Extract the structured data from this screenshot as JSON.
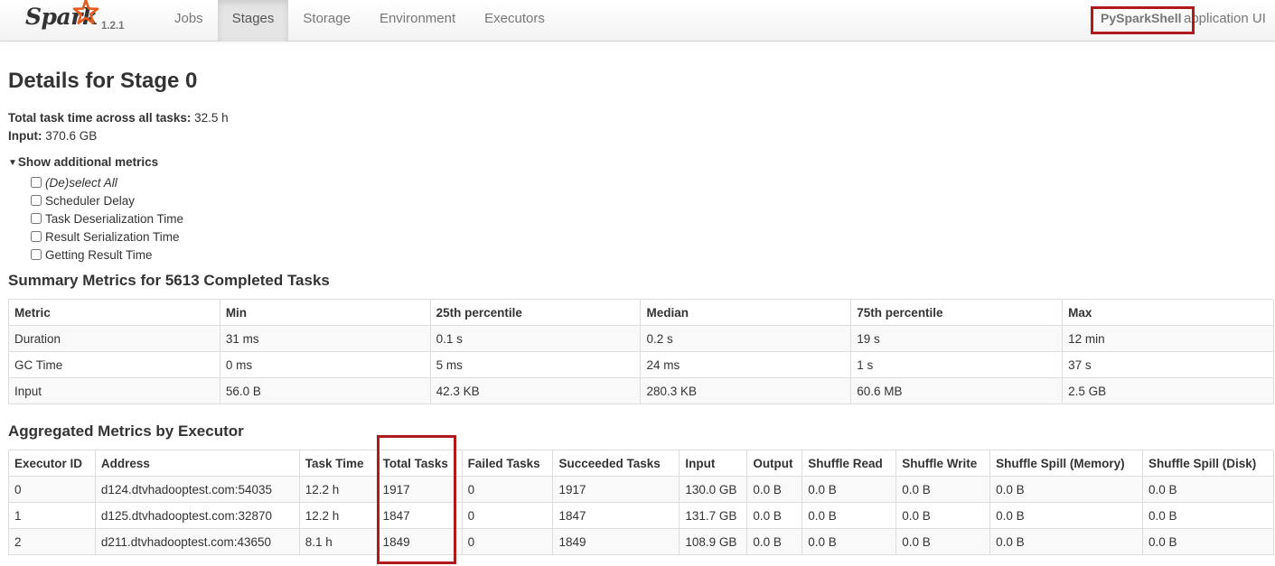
{
  "brand": {
    "name": "Spark",
    "version": "1.2.1",
    "star_color": "#e25a1c"
  },
  "nav": {
    "tabs": [
      {
        "label": "Jobs"
      },
      {
        "label": "Stages",
        "active": true
      },
      {
        "label": "Storage"
      },
      {
        "label": "Environment"
      },
      {
        "label": "Executors"
      }
    ],
    "app_name": "PySparkShell",
    "app_suffix": "application UI"
  },
  "page": {
    "title": "Details for Stage 0",
    "total_task_time_label": "Total task time across all tasks:",
    "total_task_time_value": "32.5 h",
    "input_label": "Input:",
    "input_value": "370.6 GB"
  },
  "additional_metrics": {
    "toggle_label": "Show additional metrics",
    "options": [
      {
        "label": "(De)select All",
        "italic": true
      },
      {
        "label": "Scheduler Delay"
      },
      {
        "label": "Task Deserialization Time"
      },
      {
        "label": "Result Serialization Time"
      },
      {
        "label": "Getting Result Time"
      }
    ]
  },
  "summary": {
    "title": "Summary Metrics for 5613 Completed Tasks",
    "headers": [
      "Metric",
      "Min",
      "25th percentile",
      "Median",
      "75th percentile",
      "Max"
    ],
    "rows": [
      [
        "Duration",
        "31 ms",
        "0.1 s",
        "0.2 s",
        "19 s",
        "12 min"
      ],
      [
        "GC Time",
        "0 ms",
        "5 ms",
        "24 ms",
        "1 s",
        "37 s"
      ],
      [
        "Input",
        "56.0 B",
        "42.3 KB",
        "280.3 KB",
        "60.6 MB",
        "2.5 GB"
      ]
    ]
  },
  "executors": {
    "title": "Aggregated Metrics by Executor",
    "headers": [
      "Executor ID",
      "Address",
      "Task Time",
      "Total Tasks",
      "Failed Tasks",
      "Succeeded Tasks",
      "Input",
      "Output",
      "Shuffle Read",
      "Shuffle Write",
      "Shuffle Spill (Memory)",
      "Shuffle Spill (Disk)"
    ],
    "rows": [
      [
        "0",
        "d124.dtvhadooptest.com:54035",
        "12.2 h",
        "1917",
        "0",
        "1917",
        "130.0 GB",
        "0.0 B",
        "0.0 B",
        "0.0 B",
        "0.0 B",
        "0.0 B"
      ],
      [
        "1",
        "d125.dtvhadooptest.com:32870",
        "12.2 h",
        "1847",
        "0",
        "1847",
        "131.7 GB",
        "0.0 B",
        "0.0 B",
        "0.0 B",
        "0.0 B",
        "0.0 B"
      ],
      [
        "2",
        "d211.dtvhadooptest.com:43650",
        "8.1 h",
        "1849",
        "0",
        "1849",
        "108.9 GB",
        "0.0 B",
        "0.0 B",
        "0.0 B",
        "0.0 B",
        "0.0 B"
      ]
    ]
  },
  "colors": {
    "highlight_box": "#b11a1a",
    "text": "#333333",
    "muted": "#777777"
  }
}
